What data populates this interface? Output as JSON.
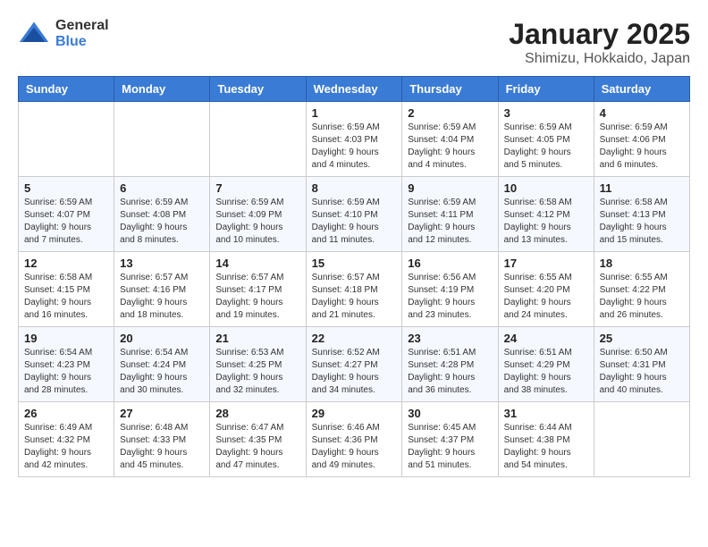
{
  "logo": {
    "general": "General",
    "blue": "Blue"
  },
  "title": "January 2025",
  "location": "Shimizu, Hokkaido, Japan",
  "weekdays": [
    "Sunday",
    "Monday",
    "Tuesday",
    "Wednesday",
    "Thursday",
    "Friday",
    "Saturday"
  ],
  "weeks": [
    [
      {
        "day": "",
        "info": ""
      },
      {
        "day": "",
        "info": ""
      },
      {
        "day": "",
        "info": ""
      },
      {
        "day": "1",
        "info": "Sunrise: 6:59 AM\nSunset: 4:03 PM\nDaylight: 9 hours\nand 4 minutes."
      },
      {
        "day": "2",
        "info": "Sunrise: 6:59 AM\nSunset: 4:04 PM\nDaylight: 9 hours\nand 4 minutes."
      },
      {
        "day": "3",
        "info": "Sunrise: 6:59 AM\nSunset: 4:05 PM\nDaylight: 9 hours\nand 5 minutes."
      },
      {
        "day": "4",
        "info": "Sunrise: 6:59 AM\nSunset: 4:06 PM\nDaylight: 9 hours\nand 6 minutes."
      }
    ],
    [
      {
        "day": "5",
        "info": "Sunrise: 6:59 AM\nSunset: 4:07 PM\nDaylight: 9 hours\nand 7 minutes."
      },
      {
        "day": "6",
        "info": "Sunrise: 6:59 AM\nSunset: 4:08 PM\nDaylight: 9 hours\nand 8 minutes."
      },
      {
        "day": "7",
        "info": "Sunrise: 6:59 AM\nSunset: 4:09 PM\nDaylight: 9 hours\nand 10 minutes."
      },
      {
        "day": "8",
        "info": "Sunrise: 6:59 AM\nSunset: 4:10 PM\nDaylight: 9 hours\nand 11 minutes."
      },
      {
        "day": "9",
        "info": "Sunrise: 6:59 AM\nSunset: 4:11 PM\nDaylight: 9 hours\nand 12 minutes."
      },
      {
        "day": "10",
        "info": "Sunrise: 6:58 AM\nSunset: 4:12 PM\nDaylight: 9 hours\nand 13 minutes."
      },
      {
        "day": "11",
        "info": "Sunrise: 6:58 AM\nSunset: 4:13 PM\nDaylight: 9 hours\nand 15 minutes."
      }
    ],
    [
      {
        "day": "12",
        "info": "Sunrise: 6:58 AM\nSunset: 4:15 PM\nDaylight: 9 hours\nand 16 minutes."
      },
      {
        "day": "13",
        "info": "Sunrise: 6:57 AM\nSunset: 4:16 PM\nDaylight: 9 hours\nand 18 minutes."
      },
      {
        "day": "14",
        "info": "Sunrise: 6:57 AM\nSunset: 4:17 PM\nDaylight: 9 hours\nand 19 minutes."
      },
      {
        "day": "15",
        "info": "Sunrise: 6:57 AM\nSunset: 4:18 PM\nDaylight: 9 hours\nand 21 minutes."
      },
      {
        "day": "16",
        "info": "Sunrise: 6:56 AM\nSunset: 4:19 PM\nDaylight: 9 hours\nand 23 minutes."
      },
      {
        "day": "17",
        "info": "Sunrise: 6:55 AM\nSunset: 4:20 PM\nDaylight: 9 hours\nand 24 minutes."
      },
      {
        "day": "18",
        "info": "Sunrise: 6:55 AM\nSunset: 4:22 PM\nDaylight: 9 hours\nand 26 minutes."
      }
    ],
    [
      {
        "day": "19",
        "info": "Sunrise: 6:54 AM\nSunset: 4:23 PM\nDaylight: 9 hours\nand 28 minutes."
      },
      {
        "day": "20",
        "info": "Sunrise: 6:54 AM\nSunset: 4:24 PM\nDaylight: 9 hours\nand 30 minutes."
      },
      {
        "day": "21",
        "info": "Sunrise: 6:53 AM\nSunset: 4:25 PM\nDaylight: 9 hours\nand 32 minutes."
      },
      {
        "day": "22",
        "info": "Sunrise: 6:52 AM\nSunset: 4:27 PM\nDaylight: 9 hours\nand 34 minutes."
      },
      {
        "day": "23",
        "info": "Sunrise: 6:51 AM\nSunset: 4:28 PM\nDaylight: 9 hours\nand 36 minutes."
      },
      {
        "day": "24",
        "info": "Sunrise: 6:51 AM\nSunset: 4:29 PM\nDaylight: 9 hours\nand 38 minutes."
      },
      {
        "day": "25",
        "info": "Sunrise: 6:50 AM\nSunset: 4:31 PM\nDaylight: 9 hours\nand 40 minutes."
      }
    ],
    [
      {
        "day": "26",
        "info": "Sunrise: 6:49 AM\nSunset: 4:32 PM\nDaylight: 9 hours\nand 42 minutes."
      },
      {
        "day": "27",
        "info": "Sunrise: 6:48 AM\nSunset: 4:33 PM\nDaylight: 9 hours\nand 45 minutes."
      },
      {
        "day": "28",
        "info": "Sunrise: 6:47 AM\nSunset: 4:35 PM\nDaylight: 9 hours\nand 47 minutes."
      },
      {
        "day": "29",
        "info": "Sunrise: 6:46 AM\nSunset: 4:36 PM\nDaylight: 9 hours\nand 49 minutes."
      },
      {
        "day": "30",
        "info": "Sunrise: 6:45 AM\nSunset: 4:37 PM\nDaylight: 9 hours\nand 51 minutes."
      },
      {
        "day": "31",
        "info": "Sunrise: 6:44 AM\nSunset: 4:38 PM\nDaylight: 9 hours\nand 54 minutes."
      },
      {
        "day": "",
        "info": ""
      }
    ]
  ]
}
